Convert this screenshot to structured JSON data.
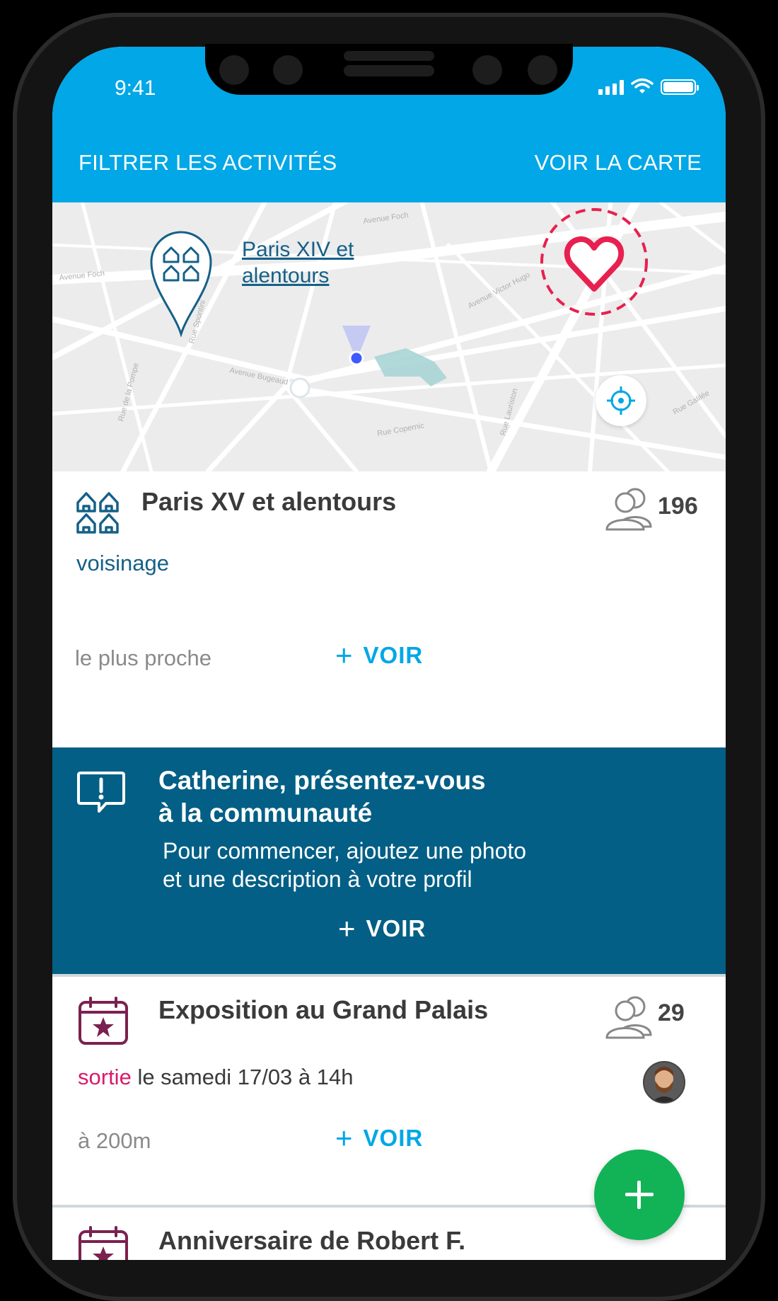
{
  "status_bar": {
    "time": "9:41"
  },
  "header": {
    "filter_label": "FILTRER LES ACTIVITÉS",
    "map_label": "VOIR LA CARTE"
  },
  "map": {
    "place_link": "Paris XIV et alentours",
    "place_link_line1": "Paris XIV et",
    "place_link_line2": "alentours",
    "street_names": [
      "Avenue Foch",
      "Villa Saïd",
      "Rue Pergolèse",
      "Avenue Victor Hugo",
      "Avenue Bugeaud",
      "Rue de la Pompe",
      "Rue Copernic",
      "Rue Lauriston",
      "Rue Galilée",
      "Rue Dumont d'Urville",
      "Rue Boissière",
      "Avenue Kléber",
      "Rue de Sontay",
      "Rue Spontini"
    ]
  },
  "cards": [
    {
      "title": "Paris XV  et alentours",
      "members": "196",
      "tag": "voisinage",
      "distance": "le plus proche",
      "action": "VOIR"
    },
    {
      "title": "Exposition au Grand Palais",
      "members": "29",
      "tag": "sortie",
      "date": "le samedi 17/03 à 14h",
      "distance": "à 200m",
      "action": "VOIR"
    },
    {
      "title": "Anniversaire de Robert F."
    }
  ],
  "banner": {
    "title_line1": "Catherine, présentez-vous",
    "title_line2": "à la communauté",
    "text_line1": "Pour commencer, ajoutez une photo",
    "text_line2": "et une description à votre profil",
    "action": "VOIR"
  },
  "colors": {
    "header": "#01a7e6",
    "banner": "#035f85",
    "accent": "#01a7e6",
    "tag_neighbourhood": "#156088",
    "tag_outing": "#d81b6b",
    "event_icon": "#7b2150",
    "heart": "#e8204f",
    "fab": "#12b356"
  },
  "icons": {
    "header_status": [
      "signal-icon",
      "wifi-icon",
      "battery-icon"
    ],
    "map": [
      "neighbourhood-pin-icon",
      "heart-icon",
      "locate-icon",
      "user-location-icon"
    ],
    "cards": [
      "neighbourhood-icon",
      "members-icon",
      "calendar-star-icon",
      "avatar"
    ],
    "fab": "plus-icon"
  }
}
